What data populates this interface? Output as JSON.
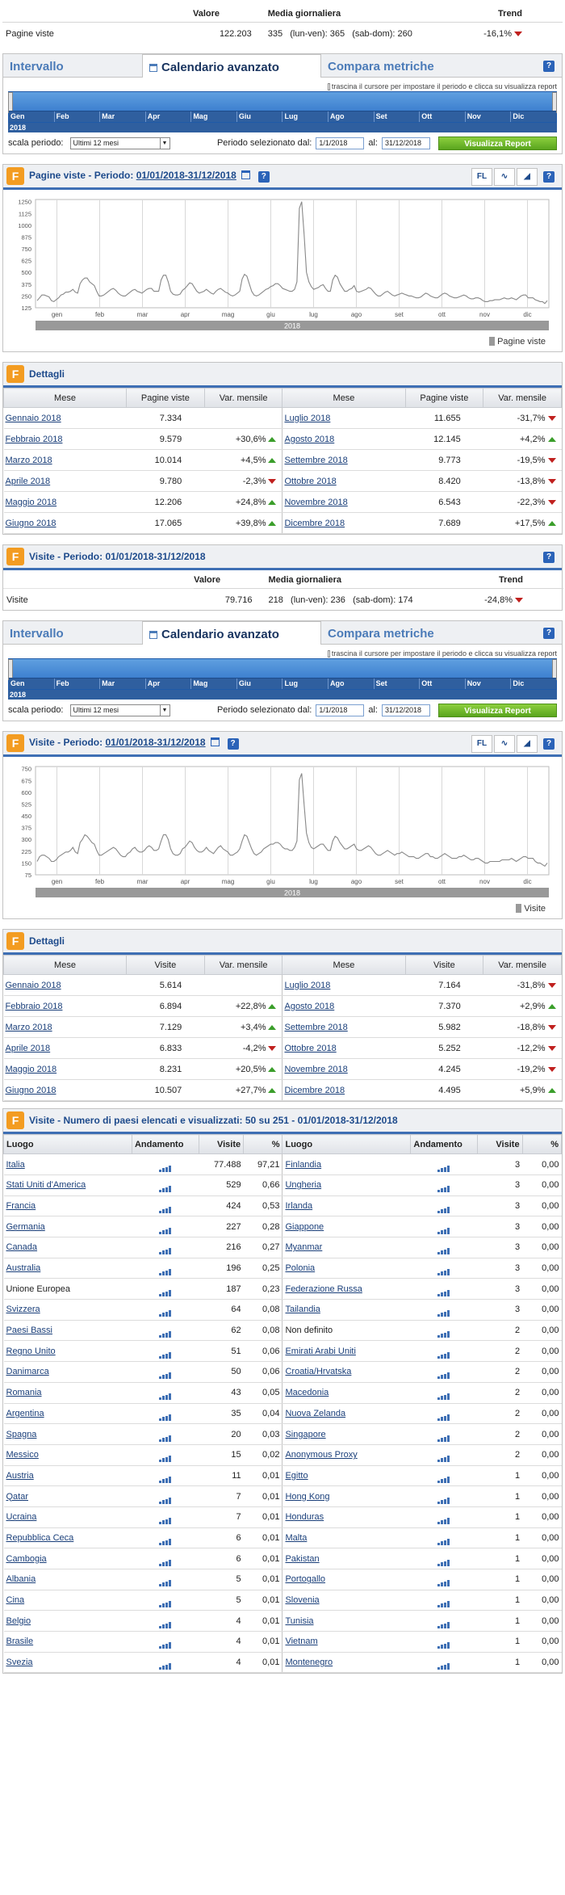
{
  "summary1": {
    "headers": [
      "Valore",
      "Media giornaliera",
      "Trend"
    ],
    "label": "Pagine viste",
    "value": "122.203",
    "avg": "335",
    "avg_detail": "(lun-ven): 365   (sab-dom): 260",
    "trend": "-16,1%"
  },
  "tabs": {
    "t1": "Intervallo",
    "t2": "Calendario avanzato",
    "t3": "Compara metriche",
    "help": "?",
    "slider_tip": "trascina il cursore per impostare il periodo e clicca su visualizza report",
    "months": [
      "Gen",
      "Feb",
      "Mar",
      "Apr",
      "Mag",
      "Giu",
      "Lug",
      "Ago",
      "Set",
      "Ott",
      "Nov",
      "Dic"
    ],
    "year": "2018",
    "scale_label": "scala periodo:",
    "scale_value": "Ultimi 12 mesi",
    "period_label": "Periodo selezionato dal:",
    "from": "1/1/2018",
    "to_label": "al:",
    "to": "31/12/2018",
    "button": "Visualizza Report"
  },
  "chart1_title": "Pagine viste - Periodo: ",
  "chart2_title": "Visite - Periodo: ",
  "period": "01/01/2018-31/12/2018",
  "tools_fl": "FL",
  "chart_data": [
    {
      "type": "line",
      "series": [
        {
          "name": "Pagine viste",
          "values": [
            200,
            230,
            260,
            260,
            250,
            240,
            200,
            190,
            210,
            230,
            260,
            270,
            290,
            290,
            300,
            320,
            290,
            280,
            380,
            420,
            440,
            440,
            400,
            380,
            360,
            300,
            250,
            250,
            260,
            280,
            300,
            320,
            330,
            310,
            280,
            260,
            250,
            250,
            270,
            290,
            310,
            320,
            300,
            290,
            280,
            300,
            320,
            330,
            330,
            300,
            300,
            300,
            420,
            470,
            470,
            400,
            300,
            270,
            260,
            260,
            270,
            310,
            330,
            360,
            390,
            380,
            340,
            300,
            280,
            290,
            300,
            320,
            300,
            280,
            270,
            300,
            320,
            330,
            310,
            290,
            280,
            260,
            250,
            260,
            280,
            300,
            430,
            480,
            460,
            380,
            300,
            260,
            250,
            260,
            280,
            300,
            320,
            330,
            350,
            360,
            380,
            380,
            360,
            330,
            320,
            310,
            300,
            300,
            320,
            400,
            1180,
            1250,
            900,
            500,
            400,
            350,
            320,
            330,
            340,
            360,
            370,
            330,
            300,
            300,
            420,
            470,
            450,
            380,
            340,
            300,
            300,
            320,
            330,
            360,
            300,
            290,
            300,
            310,
            320,
            340,
            330,
            300,
            270,
            250,
            250,
            270,
            290,
            300,
            280,
            260,
            250,
            260,
            270,
            280,
            270,
            260,
            250,
            250,
            240,
            230,
            230,
            240,
            260,
            280,
            270,
            250,
            240,
            230,
            230,
            250,
            270,
            280,
            270,
            250,
            240,
            230,
            230,
            240,
            250,
            260,
            250,
            230,
            220,
            220,
            230,
            230,
            220,
            200,
            190,
            190,
            200,
            200,
            210,
            210,
            210,
            220,
            230,
            220,
            220,
            230,
            220,
            210,
            230,
            250,
            260,
            260,
            230,
            230,
            230,
            210,
            200,
            190,
            190,
            170,
            200
          ]
        }
      ],
      "x_ticks": [
        "gen",
        "feb",
        "mar",
        "apr",
        "mag",
        "giu",
        "lug",
        "ago",
        "set",
        "ott",
        "nov",
        "dic"
      ],
      "y_ticks": [
        125,
        250,
        375,
        500,
        625,
        750,
        875,
        1000,
        1125,
        1250
      ],
      "ylim": [
        125,
        1250
      ],
      "year": "2018",
      "legend": "Pagine viste"
    },
    {
      "type": "line",
      "series": [
        {
          "name": "Visite",
          "values": [
            160,
            190,
            200,
            200,
            190,
            180,
            160,
            160,
            170,
            190,
            200,
            210,
            220,
            220,
            230,
            250,
            220,
            210,
            280,
            300,
            330,
            320,
            300,
            280,
            270,
            230,
            200,
            200,
            210,
            220,
            230,
            240,
            250,
            240,
            220,
            200,
            190,
            190,
            210,
            220,
            240,
            250,
            230,
            220,
            220,
            230,
            250,
            260,
            250,
            230,
            230,
            240,
            290,
            330,
            330,
            300,
            240,
            210,
            200,
            200,
            210,
            240,
            250,
            270,
            290,
            280,
            250,
            230,
            220,
            220,
            230,
            250,
            230,
            220,
            210,
            230,
            250,
            260,
            240,
            230,
            220,
            200,
            200,
            210,
            220,
            240,
            290,
            330,
            320,
            280,
            240,
            210,
            200,
            210,
            220,
            240,
            250,
            260,
            270,
            270,
            280,
            280,
            270,
            250,
            240,
            240,
            230,
            230,
            250,
            290,
            680,
            720,
            520,
            340,
            280,
            250,
            240,
            250,
            260,
            270,
            270,
            250,
            230,
            230,
            290,
            320,
            310,
            280,
            260,
            240,
            240,
            250,
            260,
            270,
            240,
            230,
            230,
            240,
            250,
            260,
            250,
            230,
            210,
            200,
            200,
            210,
            220,
            230,
            220,
            210,
            200,
            210,
            210,
            220,
            210,
            200,
            190,
            190,
            190,
            180,
            180,
            190,
            200,
            210,
            210,
            190,
            190,
            180,
            180,
            190,
            200,
            210,
            200,
            190,
            180,
            180,
            180,
            190,
            190,
            200,
            190,
            180,
            170,
            170,
            180,
            180,
            170,
            160,
            150,
            150,
            160,
            160,
            160,
            160,
            160,
            170,
            170,
            170,
            170,
            180,
            170,
            160,
            170,
            180,
            190,
            190,
            180,
            180,
            180,
            160,
            150,
            150,
            140,
            130,
            150
          ]
        }
      ],
      "x_ticks": [
        "gen",
        "feb",
        "mar",
        "apr",
        "mag",
        "giu",
        "lug",
        "ago",
        "set",
        "ott",
        "nov",
        "dic"
      ],
      "y_ticks": [
        75,
        150,
        225,
        300,
        375,
        450,
        525,
        600,
        675,
        750
      ],
      "ylim": [
        75,
        750
      ],
      "year": "2018",
      "legend": "Visite"
    }
  ],
  "dettagli_title": "Dettagli",
  "dettagli1": {
    "headers": [
      "Mese",
      "Pagine viste",
      "Var. mensile",
      "Mese",
      "Pagine viste",
      "Var. mensile"
    ],
    "left": [
      {
        "m": "Gennaio 2018",
        "v": "7.334",
        "var": "",
        "dir": ""
      },
      {
        "m": "Febbraio 2018",
        "v": "9.579",
        "var": "+30,6%",
        "dir": "up"
      },
      {
        "m": "Marzo 2018",
        "v": "10.014",
        "var": "+4,5%",
        "dir": "up"
      },
      {
        "m": "Aprile 2018",
        "v": "9.780",
        "var": "-2,3%",
        "dir": "down"
      },
      {
        "m": "Maggio 2018",
        "v": "12.206",
        "var": "+24,8%",
        "dir": "up"
      },
      {
        "m": "Giugno 2018",
        "v": "17.065",
        "var": "+39,8%",
        "dir": "up"
      }
    ],
    "right": [
      {
        "m": "Luglio 2018",
        "v": "11.655",
        "var": "-31,7%",
        "dir": "down"
      },
      {
        "m": "Agosto 2018",
        "v": "12.145",
        "var": "+4,2%",
        "dir": "up"
      },
      {
        "m": "Settembre 2018",
        "v": "9.773",
        "var": "-19,5%",
        "dir": "down"
      },
      {
        "m": "Ottobre 2018",
        "v": "8.420",
        "var": "-13,8%",
        "dir": "down"
      },
      {
        "m": "Novembre 2018",
        "v": "6.543",
        "var": "-22,3%",
        "dir": "down"
      },
      {
        "m": "Dicembre 2018",
        "v": "7.689",
        "var": "+17,5%",
        "dir": "up"
      }
    ]
  },
  "visite_box": {
    "title": "Visite - Periodo: 01/01/2018-31/12/2018",
    "headers": [
      "Valore",
      "Media giornaliera",
      "Trend"
    ],
    "label": "Visite",
    "value": "79.716",
    "avg": "218",
    "avg_detail": "(lun-ven): 236   (sab-dom): 174",
    "trend": "-24,8%"
  },
  "dettagli2": {
    "headers": [
      "Mese",
      "Visite",
      "Var. mensile",
      "Mese",
      "Visite",
      "Var. mensile"
    ],
    "left": [
      {
        "m": "Gennaio 2018",
        "v": "5.614",
        "var": "",
        "dir": ""
      },
      {
        "m": "Febbraio 2018",
        "v": "6.894",
        "var": "+22,8%",
        "dir": "up"
      },
      {
        "m": "Marzo 2018",
        "v": "7.129",
        "var": "+3,4%",
        "dir": "up"
      },
      {
        "m": "Aprile 2018",
        "v": "6.833",
        "var": "-4,2%",
        "dir": "down"
      },
      {
        "m": "Maggio 2018",
        "v": "8.231",
        "var": "+20,5%",
        "dir": "up"
      },
      {
        "m": "Giugno 2018",
        "v": "10.507",
        "var": "+27,7%",
        "dir": "up"
      }
    ],
    "right": [
      {
        "m": "Luglio 2018",
        "v": "7.164",
        "var": "-31,8%",
        "dir": "down"
      },
      {
        "m": "Agosto 2018",
        "v": "7.370",
        "var": "+2,9%",
        "dir": "up"
      },
      {
        "m": "Settembre 2018",
        "v": "5.982",
        "var": "-18,8%",
        "dir": "down"
      },
      {
        "m": "Ottobre 2018",
        "v": "5.252",
        "var": "-12,2%",
        "dir": "down"
      },
      {
        "m": "Novembre 2018",
        "v": "4.245",
        "var": "-19,2%",
        "dir": "down"
      },
      {
        "m": "Dicembre 2018",
        "v": "4.495",
        "var": "+5,9%",
        "dir": "up"
      }
    ]
  },
  "paesi": {
    "title": "Visite - Numero di paesi elencati e visualizzati: 50 su 251 - 01/01/2018-31/12/2018",
    "headers": [
      "Luogo",
      "Andamento",
      "Visite",
      "%",
      "Luogo",
      "Andamento",
      "Visite",
      "%"
    ],
    "left": [
      {
        "p": "Italia",
        "v": "77.488",
        "pct": "97,21",
        "link": true
      },
      {
        "p": "Stati Uniti d'America",
        "v": "529",
        "pct": "0,66",
        "link": true
      },
      {
        "p": "Francia",
        "v": "424",
        "pct": "0,53",
        "link": true
      },
      {
        "p": "Germania",
        "v": "227",
        "pct": "0,28",
        "link": true
      },
      {
        "p": "Canada",
        "v": "216",
        "pct": "0,27",
        "link": true
      },
      {
        "p": "Australia",
        "v": "196",
        "pct": "0,25",
        "link": true
      },
      {
        "p": "Unione Europea",
        "v": "187",
        "pct": "0,23",
        "link": false
      },
      {
        "p": "Svizzera",
        "v": "64",
        "pct": "0,08",
        "link": true
      },
      {
        "p": "Paesi Bassi",
        "v": "62",
        "pct": "0,08",
        "link": true
      },
      {
        "p": "Regno Unito",
        "v": "51",
        "pct": "0,06",
        "link": true
      },
      {
        "p": "Danimarca",
        "v": "50",
        "pct": "0,06",
        "link": true
      },
      {
        "p": "Romania",
        "v": "43",
        "pct": "0,05",
        "link": true
      },
      {
        "p": "Argentina",
        "v": "35",
        "pct": "0,04",
        "link": true
      },
      {
        "p": "Spagna",
        "v": "20",
        "pct": "0,03",
        "link": true
      },
      {
        "p": "Messico",
        "v": "15",
        "pct": "0,02",
        "link": true
      },
      {
        "p": "Austria",
        "v": "11",
        "pct": "0,01",
        "link": true
      },
      {
        "p": "Qatar",
        "v": "7",
        "pct": "0,01",
        "link": true
      },
      {
        "p": "Ucraina",
        "v": "7",
        "pct": "0,01",
        "link": true
      },
      {
        "p": "Repubblica Ceca",
        "v": "6",
        "pct": "0,01",
        "link": true
      },
      {
        "p": "Cambogia",
        "v": "6",
        "pct": "0,01",
        "link": true
      },
      {
        "p": "Albania",
        "v": "5",
        "pct": "0,01",
        "link": true
      },
      {
        "p": "Cina",
        "v": "5",
        "pct": "0,01",
        "link": true
      },
      {
        "p": "Belgio",
        "v": "4",
        "pct": "0,01",
        "link": true
      },
      {
        "p": "Brasile",
        "v": "4",
        "pct": "0,01",
        "link": true
      },
      {
        "p": "Svezia",
        "v": "4",
        "pct": "0,01",
        "link": true
      }
    ],
    "right": [
      {
        "p": "Finlandia",
        "v": "3",
        "pct": "0,00",
        "link": true
      },
      {
        "p": "Ungheria",
        "v": "3",
        "pct": "0,00",
        "link": true
      },
      {
        "p": "Irlanda",
        "v": "3",
        "pct": "0,00",
        "link": true
      },
      {
        "p": "Giappone",
        "v": "3",
        "pct": "0,00",
        "link": true
      },
      {
        "p": "Myanmar",
        "v": "3",
        "pct": "0,00",
        "link": true
      },
      {
        "p": "Polonia",
        "v": "3",
        "pct": "0,00",
        "link": true
      },
      {
        "p": "Federazione Russa",
        "v": "3",
        "pct": "0,00",
        "link": true
      },
      {
        "p": "Tailandia",
        "v": "3",
        "pct": "0,00",
        "link": true
      },
      {
        "p": "Non definito",
        "v": "2",
        "pct": "0,00",
        "link": false
      },
      {
        "p": "Emirati Arabi Uniti",
        "v": "2",
        "pct": "0,00",
        "link": true
      },
      {
        "p": "Croatia/Hrvatska",
        "v": "2",
        "pct": "0,00",
        "link": true
      },
      {
        "p": "Macedonia",
        "v": "2",
        "pct": "0,00",
        "link": true
      },
      {
        "p": "Nuova Zelanda",
        "v": "2",
        "pct": "0,00",
        "link": true
      },
      {
        "p": "Singapore",
        "v": "2",
        "pct": "0,00",
        "link": true
      },
      {
        "p": "Anonymous Proxy",
        "v": "2",
        "pct": "0,00",
        "link": true
      },
      {
        "p": "Egitto",
        "v": "1",
        "pct": "0,00",
        "link": true
      },
      {
        "p": "Hong Kong",
        "v": "1",
        "pct": "0,00",
        "link": true
      },
      {
        "p": "Honduras",
        "v": "1",
        "pct": "0,00",
        "link": true
      },
      {
        "p": "Malta",
        "v": "1",
        "pct": "0,00",
        "link": true
      },
      {
        "p": "Pakistan",
        "v": "1",
        "pct": "0,00",
        "link": true
      },
      {
        "p": "Portogallo",
        "v": "1",
        "pct": "0,00",
        "link": true
      },
      {
        "p": "Slovenia",
        "v": "1",
        "pct": "0,00",
        "link": true
      },
      {
        "p": "Tunisia",
        "v": "1",
        "pct": "0,00",
        "link": true
      },
      {
        "p": "Vietnam",
        "v": "1",
        "pct": "0,00",
        "link": true
      },
      {
        "p": "Montenegro",
        "v": "1",
        "pct": "0,00",
        "link": true
      }
    ]
  }
}
